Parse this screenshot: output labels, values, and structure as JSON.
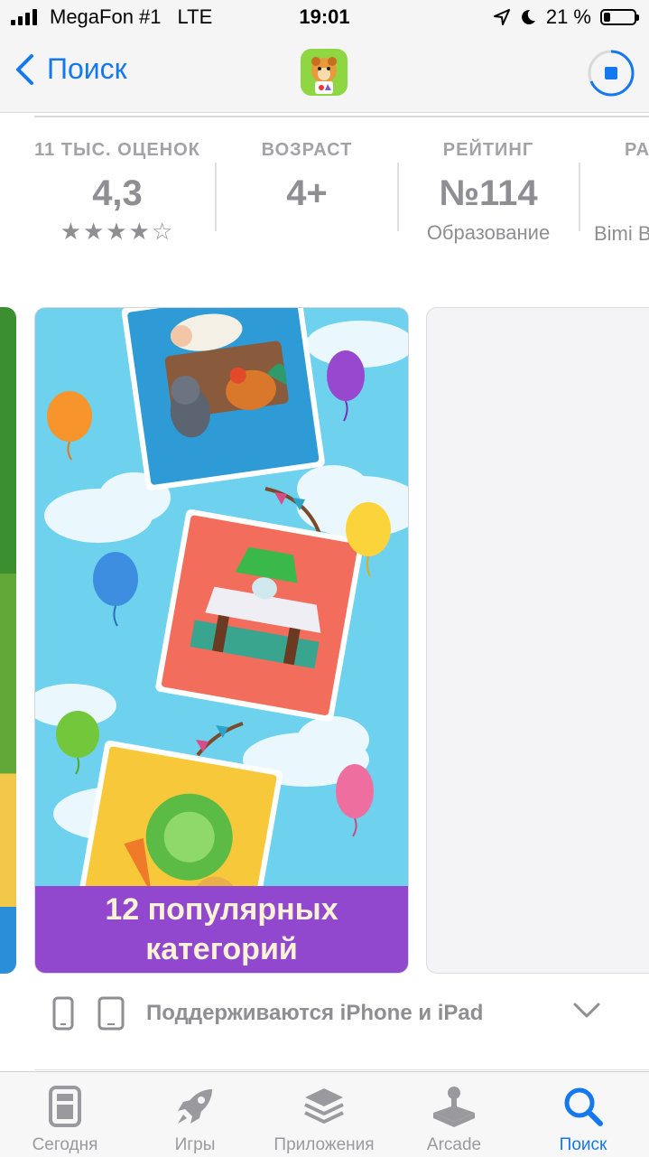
{
  "status_bar": {
    "carrier": "MegaFon #1",
    "network": "LTE",
    "time": "19:01",
    "battery": "21 %",
    "battery_level": 0.21
  },
  "nav": {
    "back_label": "Поиск",
    "icons": [
      "chevron-left-icon",
      "app-icon",
      "download-stop-icon"
    ],
    "accent": "#1478f0"
  },
  "stats": [
    {
      "label": "11 ТЫС. ОЦЕНОК",
      "value": "4,3",
      "stars": "★★★★☆",
      "rating": 4.3
    },
    {
      "label": "ВОЗРАСТ",
      "value": "4+"
    },
    {
      "label": "РЕЙТИНГ",
      "value": "№114",
      "sub": "Образование"
    },
    {
      "label": "РА",
      "value": "",
      "sub": "Bimi B"
    }
  ],
  "screenshot": {
    "banner_text": "12 популярных\nкатегорий"
  },
  "supported": {
    "text": "Поддерживаются iPhone и iPad",
    "icons": [
      "iphone-icon",
      "ipad-icon",
      "chevron-down-icon"
    ]
  },
  "tabbar": {
    "items": [
      {
        "label": "Сегодня",
        "icon": "today-icon"
      },
      {
        "label": "Игры",
        "icon": "rocket-icon"
      },
      {
        "label": "Приложения",
        "icon": "apps-stack-icon"
      },
      {
        "label": "Arcade",
        "icon": "joystick-icon"
      },
      {
        "label": "Поиск",
        "icon": "search-icon",
        "active": true
      }
    ]
  }
}
